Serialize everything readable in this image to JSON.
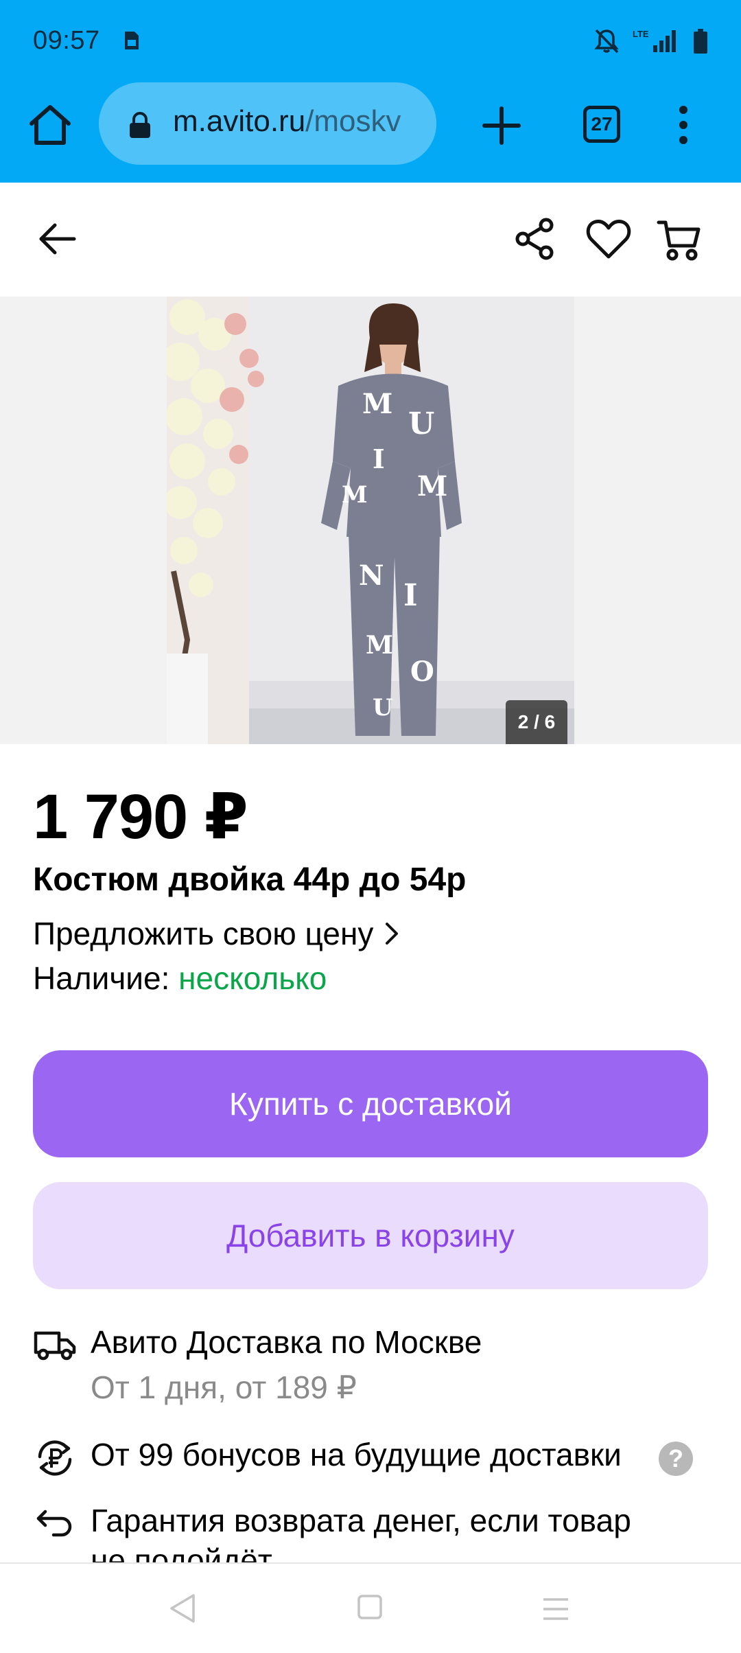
{
  "status": {
    "time": "09:57",
    "network": "LTE"
  },
  "browser": {
    "url_host": "m.avito.ru",
    "url_path": "/moskv",
    "tab_count": "27"
  },
  "gallery": {
    "counter": "2 / 6"
  },
  "product": {
    "price": "1 790 ₽",
    "title": "Костюм двойка 44р до 54р",
    "offer_label": "Предложить свою цену",
    "availability_label": "Наличие:",
    "availability_value": "несколько"
  },
  "actions": {
    "buy_label": "Купить с доставкой",
    "cart_label": "Добавить в корзину"
  },
  "delivery": {
    "title": "Авито Доставка по Москве",
    "subtitle": "От 1 дня, от 189 ₽",
    "bonus": "От 99 бонусов на будущие доставки",
    "help": "?",
    "guarantee_line1": "Гарантия возврата денег, если товар",
    "guarantee_line2": "не подойдёт"
  },
  "colors": {
    "chrome": "#03a9f4",
    "url_pill": "#4fc3f7",
    "buy_button": "#9b67f2",
    "cart_button_bg": "#e9dcfc",
    "cart_button_text": "#8a43e8",
    "availability": "#0aa64a"
  },
  "icons": {
    "status_sim": "sim-card-icon",
    "status_mute": "bell-off-icon",
    "status_signal": "signal-icon",
    "status_battery": "battery-icon",
    "home": "home-icon",
    "lock": "lock-icon",
    "new_tab": "plus-icon",
    "menu": "more-vertical-icon",
    "back": "arrow-left-icon",
    "share": "share-icon",
    "favorite": "heart-icon",
    "cart": "cart-icon",
    "offer_chevron": "chevron-right-icon",
    "delivery": "truck-icon",
    "bonus": "ruble-cycle-icon",
    "return": "return-arrow-icon",
    "nav_back": "nav-back-icon",
    "nav_home": "nav-home-icon",
    "nav_menu": "nav-menu-icon"
  }
}
